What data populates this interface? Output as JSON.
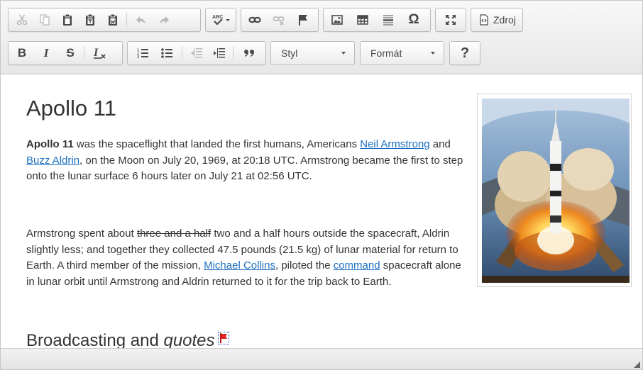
{
  "toolbar": {
    "source_label": "Zdroj",
    "styles_combo": "Styl",
    "format_combo": "Formát",
    "help_label": "?"
  },
  "content": {
    "title": "Apollo 11",
    "p1": {
      "bold": "Apollo 11",
      "t1": " was the spaceflight that landed the first humans, Americans ",
      "link1": "Neil Armstrong",
      "t2": " and ",
      "link2": "Buzz Aldrin",
      "t3": ", on the Moon on July 20, 1969, at 20:18 UTC. Armstrong became the first to step onto the lunar surface 6 hours later on July 21 at 02:56 UTC."
    },
    "p2": {
      "t1": "Armstrong spent about ",
      "struck": "three and a half",
      "t2": " two and a half hours outside the spacecraft, Aldrin slightly less; and together they collected 47.5 pounds (21.5 kg) of lunar material for return to Earth. A third member of the mission, ",
      "link1": "Michael Collins",
      "t3": ", piloted the ",
      "link2": "command",
      "t4": " spacecraft alone in lunar orbit until Armstrong and Aldrin returned to it for the trip back to Earth."
    },
    "h2": {
      "t1": "Broadcasting and ",
      "em": "quotes"
    }
  },
  "colors": {
    "link": "#1c6fc1",
    "flag": "#e02222"
  },
  "icons": [
    "cut-icon",
    "copy-icon",
    "paste-icon",
    "paste-text-icon",
    "paste-word-icon",
    "undo-icon",
    "redo-icon",
    "spellcheck-icon",
    "link-icon",
    "unlink-icon",
    "anchor-icon",
    "image-icon",
    "table-icon",
    "horizontal-rule-icon",
    "special-char-icon",
    "maximize-icon",
    "source-icon",
    "bold-icon",
    "italic-icon",
    "strikethrough-icon",
    "remove-format-icon",
    "numbered-list-icon",
    "bulleted-list-icon",
    "outdent-icon",
    "indent-icon",
    "blockquote-icon",
    "help-icon"
  ]
}
